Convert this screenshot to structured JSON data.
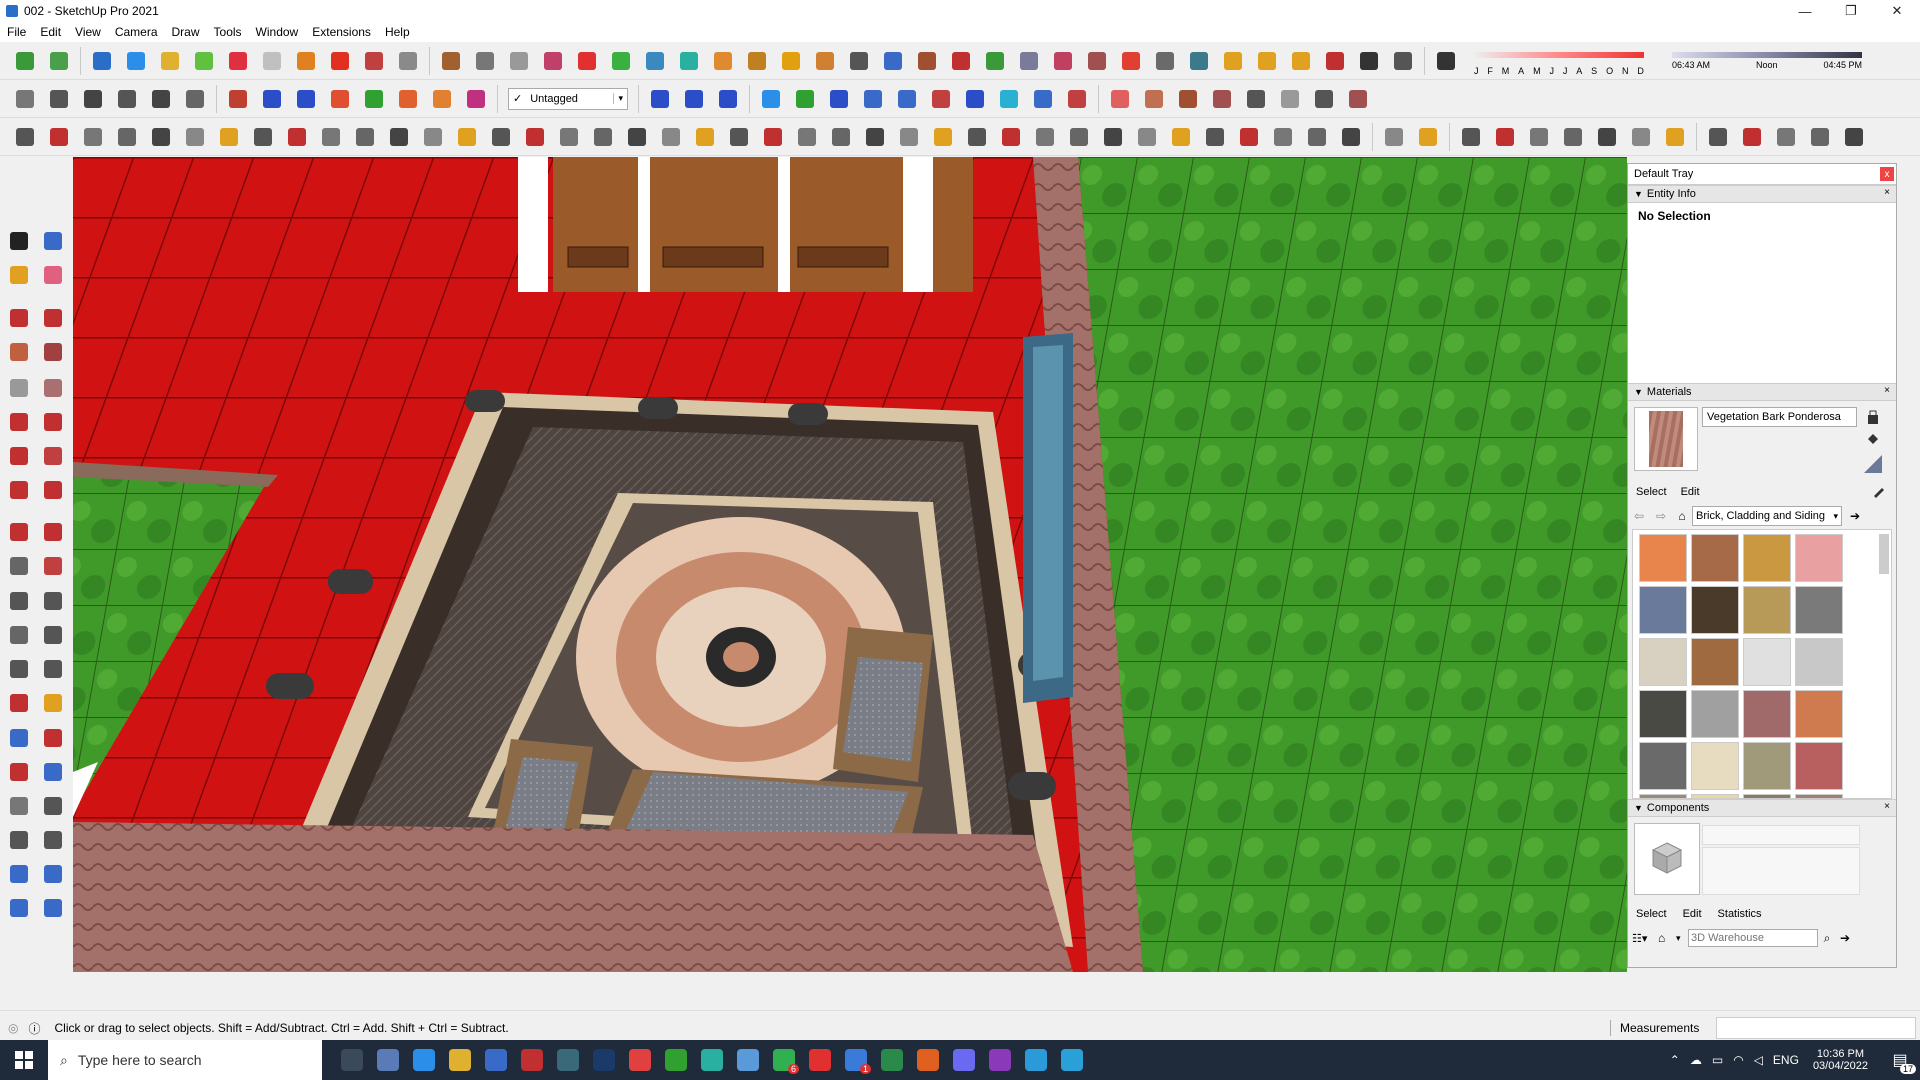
{
  "window": {
    "title": "002 - SketchUp Pro 2021",
    "minimize": "—",
    "maximize": "❐",
    "close": "✕"
  },
  "menu": [
    "File",
    "Edit",
    "View",
    "Camera",
    "Draw",
    "Tools",
    "Window",
    "Extensions",
    "Help"
  ],
  "toolbar2": {
    "tag_check": "✓",
    "tag_value": "Untagged",
    "tag_dropdown": "▾"
  },
  "shadows": {
    "months": [
      "J",
      "F",
      "M",
      "A",
      "M",
      "J",
      "J",
      "A",
      "S",
      "O",
      "N",
      "D"
    ],
    "time_start": "06:43 AM",
    "time_mid": "Noon",
    "time_end": "04:45 PM"
  },
  "tray": {
    "title": "Default Tray",
    "close": "x",
    "entity_info": {
      "header": "Entity Info",
      "selection": "No Selection"
    },
    "materials": {
      "header": "Materials",
      "material_name": "Vegetation Bark Ponderosa",
      "tab_select": "Select",
      "tab_edit": "Edit",
      "library": "Brick, Cladding and Siding"
    },
    "components": {
      "header": "Components",
      "tab_select": "Select",
      "tab_edit": "Edit",
      "tab_statistics": "Statistics",
      "search_placeholder": "3D Warehouse"
    }
  },
  "status": {
    "hint": "Click or drag to select objects. Shift = Add/Subtract. Ctrl = Add. Shift + Ctrl = Subtract.",
    "measurements_label": "Measurements"
  },
  "taskbar": {
    "search_placeholder": "Type here to search",
    "language": "ENG",
    "time": "10:36 PM",
    "date": "03/04/2022",
    "badge_whatsapp": "6",
    "badge_tasks": "1",
    "badge_notifications": "17"
  },
  "colors": {
    "floor_red": "#c41010",
    "grass": "#3f9a2a",
    "accent_blue": "#2b6ec8",
    "taskbar_bg": "#1f2a3a"
  }
}
